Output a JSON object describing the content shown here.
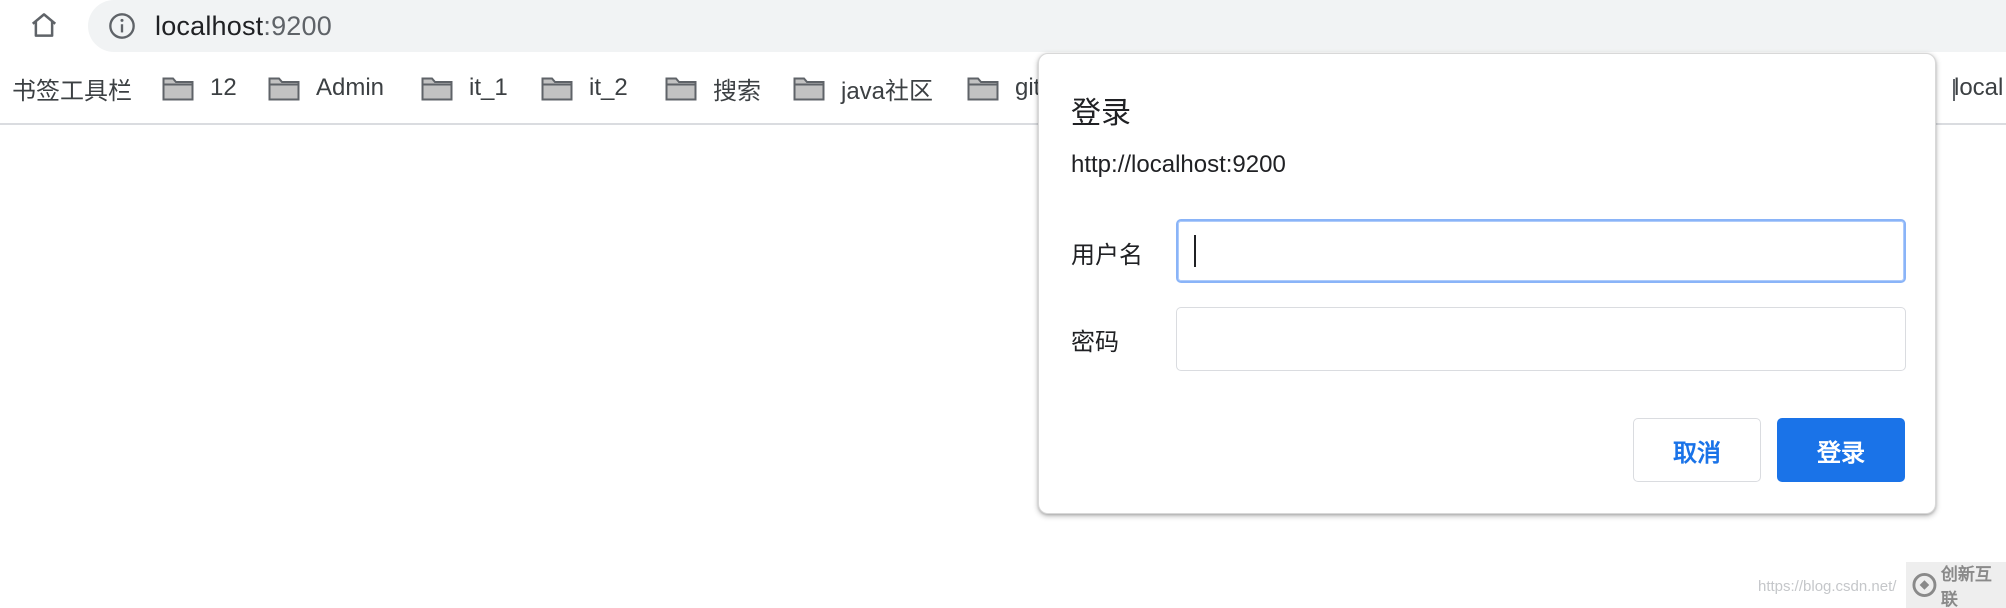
{
  "browser": {
    "url_host": "localhost",
    "url_port": ":9200"
  },
  "bookmarks": {
    "toolbar_label": "书签工具栏",
    "folders": [
      "12",
      "Admin",
      "it_1",
      "it_2",
      "搜索",
      "java社区",
      "git"
    ],
    "right_item": "local"
  },
  "dialog": {
    "title": "登录",
    "origin": "http://localhost:9200",
    "username_label": "用户名",
    "username_value": "",
    "password_label": "密码",
    "password_value": "",
    "cancel_label": "取消",
    "submit_label": "登录"
  },
  "watermark": {
    "url_text": "https://blog.csdn.net/",
    "brand_text": "创新互联"
  },
  "colors": {
    "accent": "#1a73e8",
    "focus_border": "#8ab4f8",
    "omnibox_bg": "#f1f3f4"
  }
}
